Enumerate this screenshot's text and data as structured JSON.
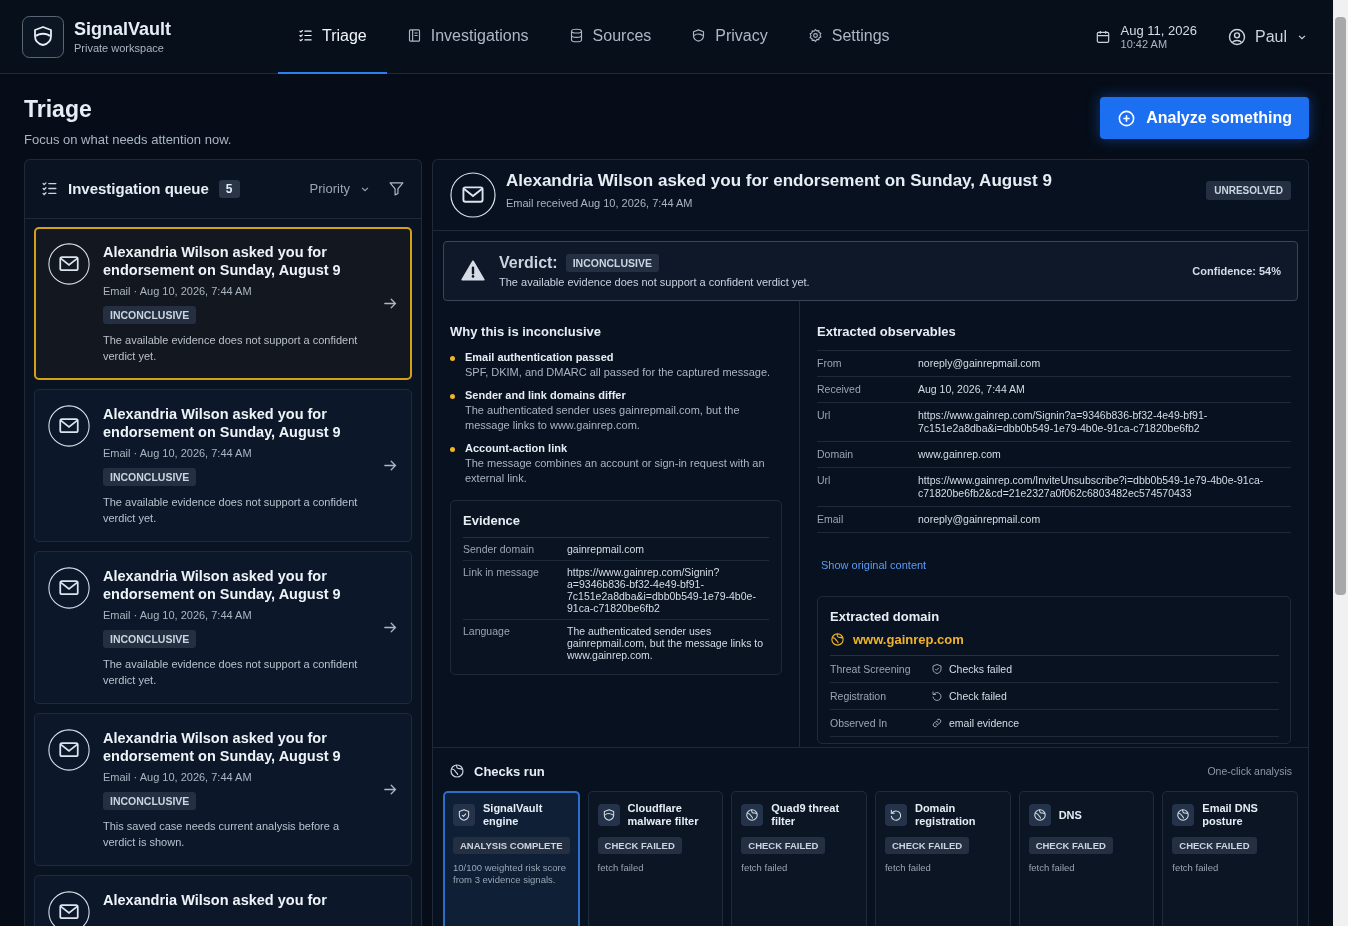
{
  "app": {
    "name": "SignalVault",
    "subtitle": "Private workspace"
  },
  "nav": [
    {
      "label": "Triage",
      "kind": "list",
      "selected": true
    },
    {
      "label": "Investigations",
      "kind": "book",
      "selected": false
    },
    {
      "label": "Sources",
      "kind": "database",
      "selected": false
    },
    {
      "label": "Privacy",
      "kind": "shield",
      "selected": false
    },
    {
      "label": "Settings",
      "kind": "gear",
      "selected": false
    }
  ],
  "datetime": {
    "date": "Aug 11, 2026",
    "time": "10:42 AM"
  },
  "user": {
    "name": "Paul"
  },
  "page": {
    "title": "Triage",
    "subtitle": "Focus on what needs attention now.",
    "action": "Analyze something"
  },
  "queue": {
    "title": "Investigation queue",
    "count": "5",
    "sort": "Priority",
    "items": [
      {
        "title": "Alexandria Wilson asked you for endorsement on Sunday, August 9",
        "meta": "Email · Aug 10, 2026, 7:44 AM",
        "status": "INCONCLUSIVE",
        "summary": "The available evidence does not support a confident verdict yet.",
        "selected": true
      },
      {
        "title": "Alexandria Wilson asked you for endorsement on Sunday, August 9",
        "meta": "Email · Aug 10, 2026, 7:44 AM",
        "status": "INCONCLUSIVE",
        "summary": "The available evidence does not support a confident verdict yet.",
        "selected": false
      },
      {
        "title": "Alexandria Wilson asked you for endorsement on Sunday, August 9",
        "meta": "Email · Aug 10, 2026, 7:44 AM",
        "status": "INCONCLUSIVE",
        "summary": "The available evidence does not support a confident verdict yet.",
        "selected": false
      },
      {
        "title": "Alexandria Wilson asked you for endorsement on Sunday, August 9",
        "meta": "Email · Aug 10, 2026, 7:44 AM",
        "status": "INCONCLUSIVE",
        "summary": "This saved case needs current analysis before a verdict is shown.",
        "selected": false
      },
      {
        "title": "Alexandria Wilson asked you for",
        "selected": false
      }
    ]
  },
  "detail": {
    "title": "Alexandria Wilson asked you for endorsement on Sunday, August 9",
    "received": "Email received Aug 10, 2026, 7:44 AM",
    "status": "UNRESOLVED",
    "verdict": {
      "label": "Verdict:",
      "value": "INCONCLUSIVE",
      "text": "The available evidence does not support a confident verdict yet.",
      "confidence": "Confidence: 54%"
    },
    "reasons": {
      "title": "Why this is inconclusive",
      "items": [
        {
          "title": "Email authentication passed",
          "text": "SPF, DKIM, and DMARC all passed for the captured message."
        },
        {
          "title": "Sender and link domains differ",
          "text": "The authenticated sender uses gainrepmail.com, but the message links to www.gainrep.com."
        },
        {
          "title": "Account-action link",
          "text": "The message combines an account or sign-in request with an external link."
        }
      ]
    },
    "evidence": {
      "title": "Evidence",
      "rows": [
        {
          "label": "Sender domain",
          "value": "gainrepmail.com"
        },
        {
          "label": "Link in message",
          "value": "https://www.gainrep.com/Signin?a=9346b836-bf32-4e49-bf91-7c151e2a8dba&i=dbb0b549-1e79-4b0e-91ca-c71820be6fb2"
        },
        {
          "label": "Language",
          "value": "The authenticated sender uses gainrepmail.com, but the message links to www.gainrep.com."
        }
      ]
    },
    "observables": {
      "title": "Extracted observables",
      "rows": [
        {
          "label": "From",
          "value": "noreply@gainrepmail.com"
        },
        {
          "label": "Received",
          "value": "Aug 10, 2026, 7:44 AM"
        },
        {
          "label": "Url",
          "value": "https://www.gainrep.com/Signin?a=9346b836-bf32-4e49-bf91-7c151e2a8dba&i=dbb0b549-1e79-4b0e-91ca-c71820be6fb2"
        },
        {
          "label": "Domain",
          "value": "www.gainrep.com"
        },
        {
          "label": "Url",
          "value": "https://www.gainrep.com/InviteUnsubscribe?i=dbb0b549-1e79-4b0e-91ca-c71820be6fb2&cd=21e2327a0f062c6803482ec574570433"
        },
        {
          "label": "Email",
          "value": "noreply@gainrepmail.com"
        }
      ]
    },
    "show_original": "Show original content",
    "domain": {
      "title": "Extracted domain",
      "name": "www.gainrep.com",
      "rows": [
        {
          "label": "Threat Screening",
          "kind": "shield",
          "value": "Checks failed"
        },
        {
          "label": "Registration",
          "kind": "refresh",
          "value": "Check failed"
        },
        {
          "label": "Observed In",
          "kind": "link",
          "value": "email evidence"
        }
      ]
    },
    "checks": {
      "title": "Checks run",
      "note": "One-click analysis",
      "items": [
        {
          "name": "SignalVault engine",
          "kind": "shield",
          "status": "ANALYSIS COMPLETE",
          "detail": "10/100 weighted risk score from 3 evidence signals.",
          "selected": true
        },
        {
          "name": "Cloudflare malware filter",
          "kind": "filter",
          "status": "CHECK FAILED",
          "detail": "fetch failed",
          "selected": false
        },
        {
          "name": "Quad9 threat filter",
          "kind": "dns",
          "status": "CHECK FAILED",
          "detail": "fetch failed",
          "selected": false
        },
        {
          "name": "Domain registration",
          "kind": "registration",
          "status": "CHECK FAILED",
          "detail": "fetch failed",
          "selected": false
        },
        {
          "name": "DNS",
          "kind": "dns",
          "status": "CHECK FAILED",
          "detail": "fetch failed",
          "selected": false
        },
        {
          "name": "Email DNS posture",
          "kind": "dns",
          "status": "CHECK FAILED",
          "detail": "fetch failed",
          "selected": false
        }
      ]
    }
  }
}
